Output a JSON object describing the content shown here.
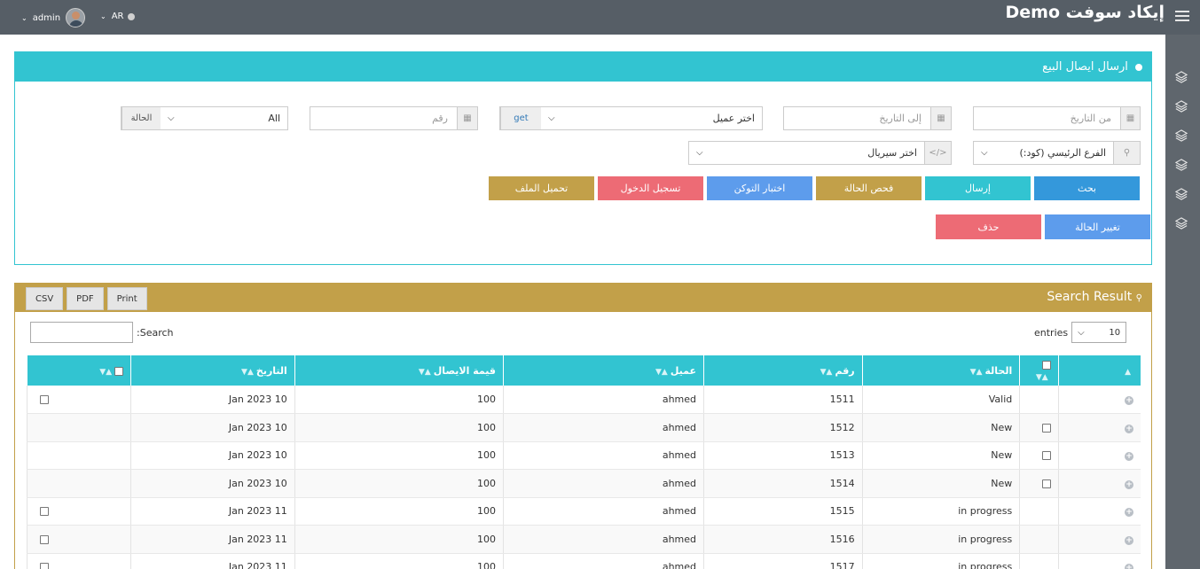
{
  "header": {
    "brand": "إيكاد سوفت Demo",
    "user_name": "admin",
    "lang": "AR"
  },
  "form": {
    "title": "ارسال ايصال البيع",
    "from_date_placeholder": "من التاريخ",
    "to_date_placeholder": "إلى التاريخ",
    "client_select": "اختر عميل",
    "get_label": "get",
    "number_placeholder": "رقم",
    "status_label": "الحالة",
    "status_value": "All",
    "branch_select": "الفرع الرئيسي (كود:)",
    "serial_select": "اختر سيريال",
    "buttons": {
      "search": "بحث",
      "send": "إرسال",
      "check_status": "فحص الحالة",
      "test_token": "اختبار التوكن",
      "login": "تسجيل الدخول",
      "upload_file": "تحميل الملف",
      "change_status": "تغيير الحالة",
      "delete": "حذف"
    }
  },
  "results": {
    "title": "Search Result",
    "export": {
      "csv": "CSV",
      "pdf": "PDF",
      "print": "Print"
    },
    "entries_label": "entries",
    "entries_value": "10",
    "search_label": ":Search",
    "columns": {
      "status": "الحالة",
      "number": "رقم",
      "client": "عميل",
      "receipt_value": "قيمة الايصال",
      "date": "التاريخ"
    },
    "rows": [
      {
        "status": "Valid",
        "number": "1511",
        "client": "ahmed",
        "value": "100",
        "date": "Jan 2023 10",
        "status_cb": false,
        "end_cb": true
      },
      {
        "status": "New",
        "number": "1512",
        "client": "ahmed",
        "value": "100",
        "date": "Jan 2023 10",
        "status_cb": true,
        "end_cb": false
      },
      {
        "status": "New",
        "number": "1513",
        "client": "ahmed",
        "value": "100",
        "date": "Jan 2023 10",
        "status_cb": true,
        "end_cb": false
      },
      {
        "status": "New",
        "number": "1514",
        "client": "ahmed",
        "value": "100",
        "date": "Jan 2023 10",
        "status_cb": true,
        "end_cb": false
      },
      {
        "status": "in progress",
        "number": "1515",
        "client": "ahmed",
        "value": "100",
        "date": "Jan 2023 11",
        "status_cb": false,
        "end_cb": true
      },
      {
        "status": "in progress",
        "number": "1516",
        "client": "ahmed",
        "value": "100",
        "date": "Jan 2023 11",
        "status_cb": false,
        "end_cb": true
      },
      {
        "status": "in progress",
        "number": "1517",
        "client": "ahmed",
        "value": "100",
        "date": "Jan 2023 11",
        "status_cb": false,
        "end_cb": true
      }
    ]
  },
  "colors": {
    "cyan": "#32c4d1",
    "gold": "#c2a049",
    "blue": "#3498db",
    "red": "#ed6b75",
    "topbar": "#565e66"
  },
  "icons": {
    "sidebar": [
      "layers-icon",
      "layers-icon",
      "layers-icon",
      "layers-icon",
      "layers-icon",
      "layers-icon"
    ]
  }
}
